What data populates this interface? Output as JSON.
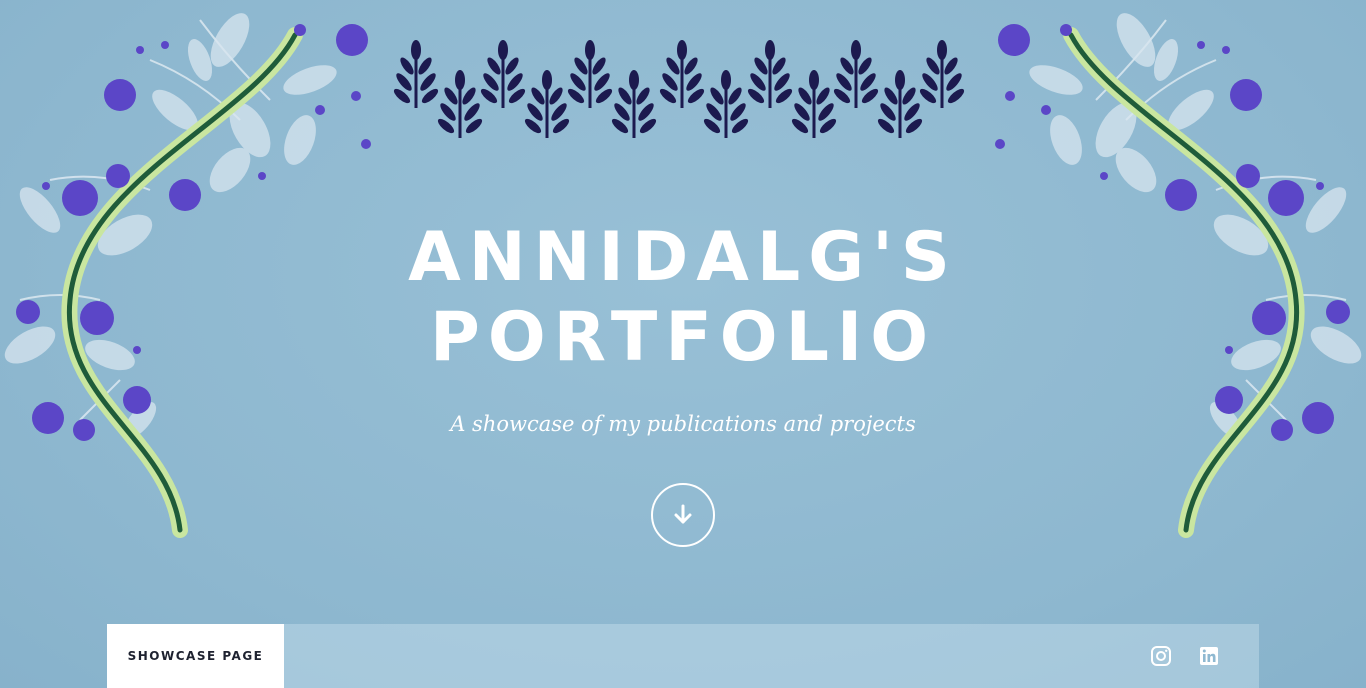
{
  "hero": {
    "title": "ANNIDALG'S PORTFOLIO",
    "subtitle": "A showcase of my publications and projects",
    "scroll_icon": "arrow-down-icon"
  },
  "nav": {
    "tab_label": "SHOWCASE PAGE",
    "social_icons": [
      "instagram-icon",
      "linkedin-icon"
    ]
  },
  "colors": {
    "background": "#8fb9d1",
    "vine_green": "#1f5c3a",
    "vine_light": "#c9e6a0",
    "berry": "#5b46c7",
    "leaf": "#cfe0ec",
    "sprig": "#1c1a4f",
    "text": "#ffffff"
  },
  "decorations": [
    "floral-vine-left",
    "floral-vine-right",
    "leaf-sprig-garland"
  ]
}
